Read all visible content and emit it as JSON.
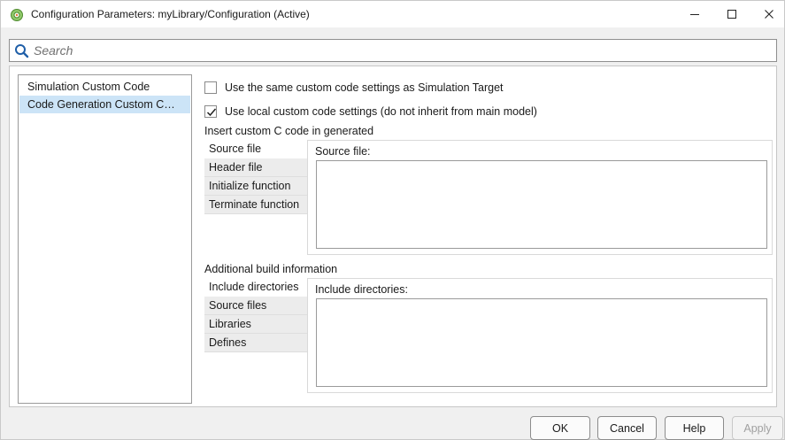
{
  "window": {
    "title": "Configuration Parameters: myLibrary/Configuration (Active)"
  },
  "search": {
    "placeholder": "Search",
    "value": ""
  },
  "tree": {
    "items": [
      {
        "label": "Simulation Custom Code",
        "selected": false
      },
      {
        "label": "Code Generation Custom C…",
        "selected": true
      }
    ]
  },
  "options": {
    "same_settings": {
      "label": "Use the same custom code settings as Simulation Target",
      "checked": false
    },
    "local_settings": {
      "label": "Use local custom code settings (do not inherit from main model)",
      "checked": true
    }
  },
  "insert_section": {
    "label": "Insert custom C code in generated",
    "tabs": [
      "Source file",
      "Header file",
      "Initialize function",
      "Terminate function"
    ],
    "active_tab": "Source file",
    "panel_label": "Source file:",
    "value": ""
  },
  "build_section": {
    "label": "Additional build information",
    "tabs": [
      "Include directories",
      "Source files",
      "Libraries",
      "Defines"
    ],
    "active_tab": "Include directories",
    "panel_label": "Include directories:",
    "value": ""
  },
  "buttons": {
    "ok": "OK",
    "cancel": "Cancel",
    "help": "Help",
    "apply": "Apply"
  },
  "colors": {
    "selection": "#cce4f7",
    "window_bg": "#f0f0f0"
  }
}
